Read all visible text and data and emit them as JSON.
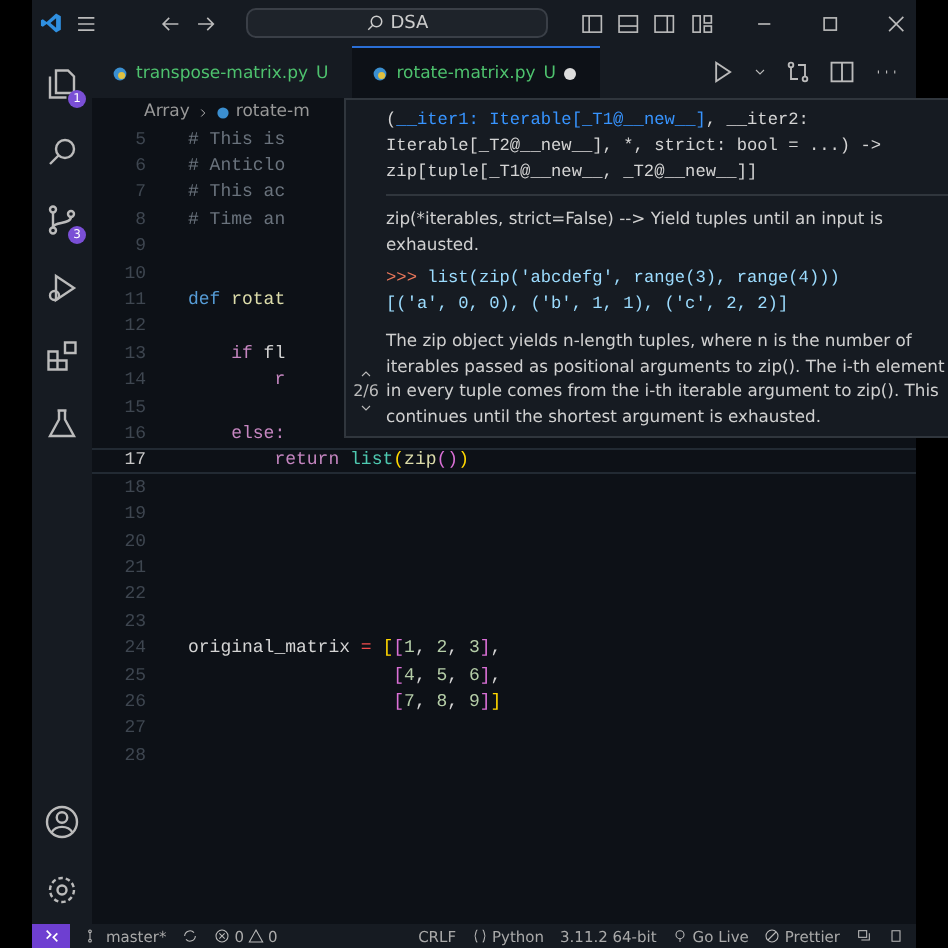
{
  "title_bar": {
    "search": "DSA"
  },
  "activity_bar": {
    "items": [
      {
        "kind": "files",
        "badge": "1"
      },
      {
        "kind": "search"
      },
      {
        "kind": "branch",
        "badge": "3"
      },
      {
        "kind": "debug"
      },
      {
        "kind": "extensions"
      },
      {
        "kind": "flask"
      }
    ],
    "bottom": [
      {
        "kind": "account"
      },
      {
        "kind": "gear"
      }
    ]
  },
  "tabs": [
    {
      "label": "transpose-matrix.py",
      "status": "U",
      "selected": false,
      "modified": false
    },
    {
      "label": "rotate-matrix.py",
      "status": "U",
      "selected": true,
      "modified": true
    }
  ],
  "breadcrumb": [
    "Array",
    "rotate-m"
  ],
  "editor": {
    "lines": [
      {
        "number": "5",
        "tokens": [
          {
            "text": "# This is",
            "kind": "comment"
          }
        ]
      },
      {
        "number": "6",
        "tokens": [
          {
            "text": "# Anticlo",
            "kind": "comment"
          }
        ]
      },
      {
        "number": "7",
        "tokens": [
          {
            "text": "# This ac",
            "kind": "comment"
          }
        ]
      },
      {
        "number": "8",
        "tokens": [
          {
            "text": "# Time an",
            "kind": "comment"
          }
        ]
      },
      {
        "number": "9"
      },
      {
        "number": "10"
      },
      {
        "number": "11",
        "tokens": [
          {
            "text": "def",
            "kind": "keyword"
          },
          {
            "text": " rotat",
            "kind": "func"
          }
        ]
      },
      {
        "number": "12"
      },
      {
        "number": "13",
        "tokens": [
          {
            "text": "    if",
            "kind": "control"
          },
          {
            "text": " fl",
            "kind": "plain"
          }
        ]
      },
      {
        "number": "14",
        "tokens": [
          {
            "text": "        r",
            "kind": "control"
          }
        ]
      },
      {
        "number": "15"
      },
      {
        "number": "16",
        "tokens": [
          {
            "text": "    else:",
            "kind": "control"
          }
        ]
      },
      {
        "number": "17",
        "current": true,
        "tokens": [
          {
            "text": "        return",
            "kind": "control"
          },
          {
            "text": " list",
            "kind": "type"
          },
          {
            "text": "(",
            "kind": "bracket"
          },
          {
            "text": "zip",
            "kind": "func"
          },
          {
            "text": "()",
            "kind": "bracket2"
          },
          {
            "text": ")",
            "kind": "bracket"
          }
        ]
      },
      {
        "number": "18"
      },
      {
        "number": "19"
      },
      {
        "number": "20"
      },
      {
        "number": "21"
      },
      {
        "number": "22"
      },
      {
        "number": "23"
      },
      {
        "number": "24",
        "tokens": [
          {
            "text": "original_matrix",
            "kind": "plain"
          },
          {
            "text": " = ",
            "kind": "operator"
          },
          {
            "text": "[",
            "kind": "bracket"
          },
          {
            "text": "[",
            "kind": "bracket2"
          },
          {
            "text": "1",
            "kind": "number"
          },
          {
            "text": ", ",
            "kind": "plain"
          },
          {
            "text": "2",
            "kind": "number"
          },
          {
            "text": ", ",
            "kind": "plain"
          },
          {
            "text": "3",
            "kind": "number"
          },
          {
            "text": "]",
            "kind": "bracket2"
          },
          {
            "text": ",",
            "kind": "plain"
          }
        ]
      },
      {
        "number": "25",
        "tokens": [
          {
            "text": "                   [",
            "kind": "bracket2"
          },
          {
            "text": "4",
            "kind": "number"
          },
          {
            "text": ", ",
            "kind": "plain"
          },
          {
            "text": "5",
            "kind": "number"
          },
          {
            "text": ", ",
            "kind": "plain"
          },
          {
            "text": "6",
            "kind": "number"
          },
          {
            "text": "]",
            "kind": "bracket2"
          },
          {
            "text": ",",
            "kind": "plain"
          }
        ]
      },
      {
        "number": "26",
        "tokens": [
          {
            "text": "                   [",
            "kind": "bracket2"
          },
          {
            "text": "7",
            "kind": "number"
          },
          {
            "text": ", ",
            "kind": "plain"
          },
          {
            "text": "8",
            "kind": "number"
          },
          {
            "text": ", ",
            "kind": "plain"
          },
          {
            "text": "9",
            "kind": "number"
          },
          {
            "text": "]",
            "kind": "bracket2"
          },
          {
            "text": "]",
            "kind": "bracket"
          }
        ]
      },
      {
        "number": "27"
      },
      {
        "number": "28"
      }
    ]
  },
  "hover": {
    "signature": [
      [
        {
          "text": "(",
          "kind": "plain"
        },
        {
          "text": "__iter1: Iterable[_T1@__new__]",
          "kind": "param"
        },
        {
          "text": ", __iter2:",
          "kind": "plain"
        }
      ],
      [
        {
          "text": "Iterable[_T2@__new__], *, strict: bool = ...) ->",
          "kind": "plain"
        }
      ],
      [
        {
          "text": "zip[tuple[_T1@__new__, _T2@__new__]]",
          "kind": "plain"
        }
      ]
    ],
    "summary": "zip(*iterables, strict=False) --> Yield tuples until an input is exhausted.",
    "example": {
      "prompt": ">>>",
      "code": "list(zip('abcdefg', range(3), range(4)))",
      "result": "[('a', 0, 0), ('b', 1, 1), ('c', 2, 2)]"
    },
    "body": "The zip object yields n-length tuples, where n is the number of iterables passed as positional arguments to zip(). The i-th element in every tuple comes from the i-th iterable argument to zip(). This continues until the shortest argument is exhausted.",
    "pager": "2/6"
  },
  "status_bar": {
    "branch": "master*",
    "errors": "0",
    "warnings": "0",
    "items": [
      "CRLF",
      "Python",
      "3.11.2 64-bit",
      "Go Live",
      "Prettier"
    ]
  }
}
